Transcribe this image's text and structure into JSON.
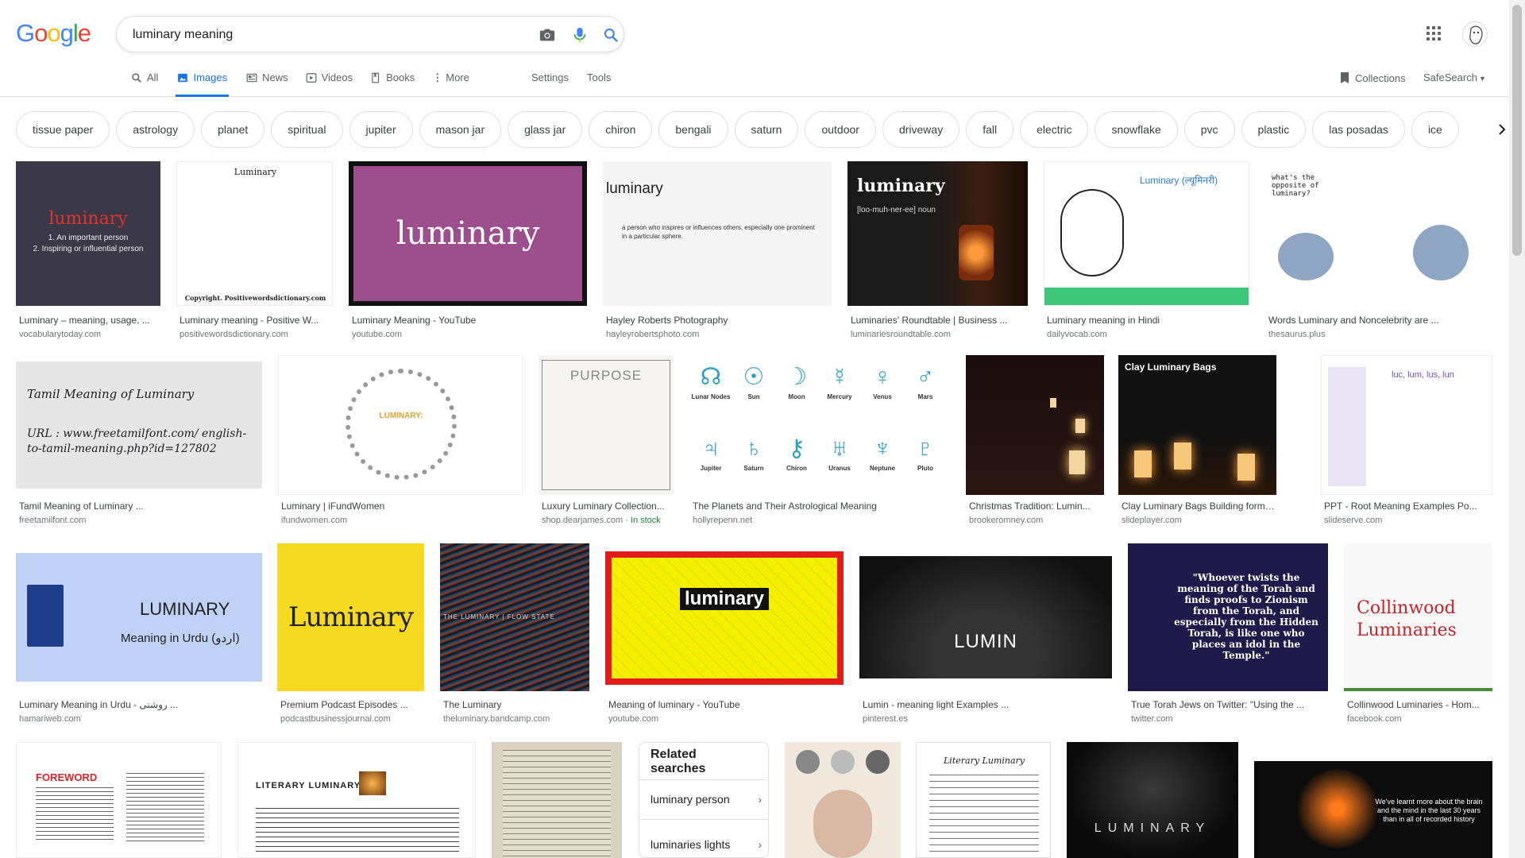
{
  "search": {
    "query": "luminary meaning"
  },
  "logo": {
    "letters": [
      "G",
      "o",
      "o",
      "g",
      "l",
      "e"
    ],
    "colors": [
      "#4285f4",
      "#ea4335",
      "#fbbc05",
      "#4285f4",
      "#34a853",
      "#ea4335"
    ]
  },
  "tabs": [
    {
      "label": "All",
      "icon": "search-icon"
    },
    {
      "label": "Images",
      "icon": "image-icon",
      "active": true
    },
    {
      "label": "News",
      "icon": "news-icon"
    },
    {
      "label": "Videos",
      "icon": "video-icon"
    },
    {
      "label": "Books",
      "icon": "book-icon"
    },
    {
      "label": "More",
      "icon": "kebab-icon"
    }
  ],
  "tools": {
    "settings": "Settings",
    "tools": "Tools"
  },
  "right": {
    "collections": "Collections",
    "safesearch": "SafeSearch"
  },
  "chips": [
    "tissue paper",
    "astrology",
    "planet",
    "spiritual",
    "jupiter",
    "mason jar",
    "glass jar",
    "chiron",
    "bengali",
    "saturn",
    "outdoor",
    "driveway",
    "fall",
    "electric",
    "snowflake",
    "pvc",
    "plastic",
    "las posadas",
    "ice"
  ],
  "results": [
    {
      "title": "Luminary – meaning, usage, ...",
      "source": "vocabularytoday.com",
      "thumb_text": "luminary",
      "thumb_sub": "1. An important person\n2. Inspiring or influential person"
    },
    {
      "title": "Luminary meaning - Positive W...",
      "source": "positivewordsdictionary.com",
      "thumb_text": "Luminary",
      "thumb_sub": "Copyright. Positivewordsdictionary.com"
    },
    {
      "title": "Luminary Meaning - YouTube",
      "source": "youtube.com",
      "thumb_text": "luminary"
    },
    {
      "title": "Hayley Roberts Photography",
      "source": "hayleyrobertsphoto.com",
      "thumb_text": "luminary",
      "thumb_sub": "a person who inspires or influences others, especially one prominent in a particular sphere."
    },
    {
      "title": "Luminaries' Roundtable | Business ...",
      "source": "luminariesroundtable.com",
      "thumb_text": "luminary",
      "thumb_sub": "[loo-muh-ner-ee] noun"
    },
    {
      "title": "Luminary meaning in Hindi",
      "source": "dailyvocab.com",
      "thumb_text": "Luminary (ल्यूमिनरी)"
    },
    {
      "title": "Words Luminary and Noncelebrity are ...",
      "source": "thesaurus.plus",
      "thumb_text": "what's the opposite of luminary?"
    },
    {
      "title": "Tamil Meaning of Luminary ...",
      "source": "freetamilfont.com",
      "thumb_text": "Tamil Meaning of Luminary",
      "thumb_sub": "URL : www.freetamilfont.com/ english-to-tamil-meaning.php?id=127802"
    },
    {
      "title": "Luminary | iFundWomen",
      "source": "ifundwomen.com",
      "thumb_text": "LUMINARY:"
    },
    {
      "title": "Luxury Luminary Collection...",
      "source": "shop.dearjames.com",
      "extra": "In stock",
      "thumb_text": "PURPOSE"
    },
    {
      "title": "The Planets and Their Astrological Meaning",
      "source": "hollyrepenn.net"
    },
    {
      "title": "Christmas Tradition: Lumin...",
      "source": "brookeromney.com"
    },
    {
      "title": "Clay Luminary Bags Building form with...",
      "source": "slideplayer.com",
      "thumb_text": "Clay Luminary Bags"
    },
    {
      "title": "PPT - Root Meaning Examples Po...",
      "source": "slideserve.com",
      "thumb_text": "luc, lum, lus, lun"
    },
    {
      "title": "Luminary Meaning in Urdu - روشنی ...",
      "source": "hamariweb.com",
      "thumb_text": "LUMINARY",
      "thumb_sub": "Meaning in Urdu (اردو)"
    },
    {
      "title": "Premium Podcast Episodes ...",
      "source": "podcastbusinessjournal.com",
      "thumb_text": "Luminary"
    },
    {
      "title": "The Luminary",
      "source": "theluminary.bandcamp.com",
      "thumb_text": "THE LUMINARY | FLOW STATE"
    },
    {
      "title": "Meaning of luminary - YouTube",
      "source": "youtube.com",
      "thumb_text": "luminary"
    },
    {
      "title": "Lumin - meaning light Examples ...",
      "source": "pinterest.es",
      "thumb_text": "LUMIN"
    },
    {
      "title": "True Torah Jews on Twitter: \"Using the ...",
      "source": "twitter.com",
      "thumb_text": "\"Whoever twists the meaning of the Torah and finds proofs to Zionism from the Torah, and especially from the Hidden Torah, is like one who places an idol in the Temple.\""
    },
    {
      "title": "Collinwood Luminaries - Hom...",
      "source": "facebook.com",
      "thumb_text": "Collinwood Luminaries"
    },
    {
      "thumb_text": "FOREWORD"
    },
    {
      "thumb_text": "LITERARY LUMINARY"
    },
    {
      "thumb_text": ""
    },
    {
      "thumb_text": ""
    },
    {
      "thumb_text": "Literary Luminary"
    },
    {
      "thumb_text": "LUMINARY"
    },
    {
      "thumb_text": "We've learnt more about the brain and the mind in the last 30 years than in all of recorded history"
    }
  ],
  "planets": {
    "glyphs": [
      "☊",
      "☉",
      "☽",
      "☿",
      "♀",
      "♂",
      "♃",
      "♄",
      "⚷",
      "♅",
      "♆",
      "♇"
    ],
    "names": [
      "Lunar Nodes",
      "Sun",
      "Moon",
      "Mercury",
      "Venus",
      "Mars",
      "Jupiter",
      "Saturn",
      "Chiron",
      "Uranus",
      "Neptune",
      "Pluto"
    ]
  },
  "related": {
    "title": "Related searches",
    "items": [
      "luminary person",
      "luminaries lights"
    ]
  }
}
